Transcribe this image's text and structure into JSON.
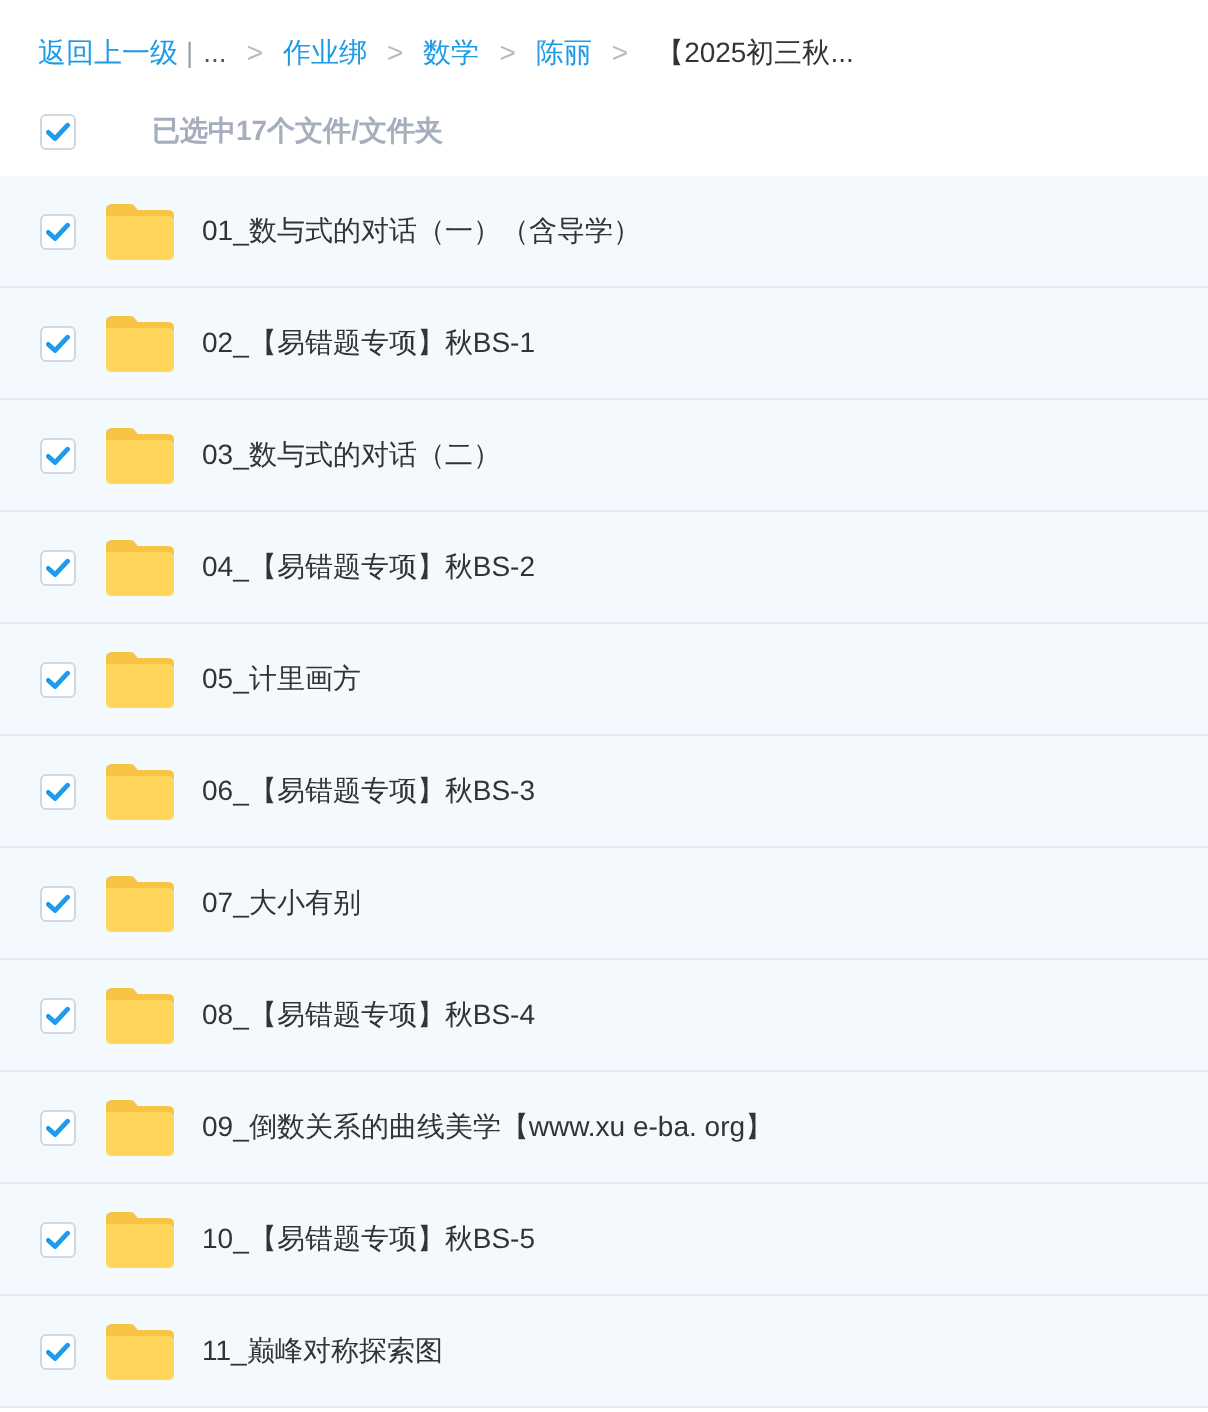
{
  "breadcrumb": {
    "back": "返回上一级",
    "divider": "|",
    "crumbs": [
      {
        "kind": "ellipsis",
        "label": "..."
      },
      {
        "kind": "link",
        "separator": ">",
        "label": "作业绑"
      },
      {
        "kind": "link",
        "separator": ">",
        "label": "数学"
      },
      {
        "kind": "link",
        "separator": ">",
        "label": "陈丽"
      },
      {
        "kind": "current",
        "separator": ">",
        "label": "【2025初三秋..."
      }
    ]
  },
  "select_all": {
    "checked": true,
    "label": "已选中17个文件/文件夹"
  },
  "files": [
    {
      "name": "01_数与式的对话（一）（含导学）",
      "checked": true
    },
    {
      "name": "02_【易错题专项】秋BS-1",
      "checked": true
    },
    {
      "name": "03_数与式的对话（二）",
      "checked": true
    },
    {
      "name": "04_【易错题专项】秋BS-2",
      "checked": true
    },
    {
      "name": "05_计里画方",
      "checked": true
    },
    {
      "name": "06_【易错题专项】秋BS-3",
      "checked": true
    },
    {
      "name": "07_大小有别",
      "checked": true
    },
    {
      "name": "08_【易错题专项】秋BS-4",
      "checked": true
    },
    {
      "name": "09_倒数关系的曲线美学【www.xu e-ba. org】",
      "checked": true
    },
    {
      "name": "10_【易错题专项】秋BS-5",
      "checked": true
    },
    {
      "name": "11_巅峰对称探索图",
      "checked": true
    }
  ]
}
